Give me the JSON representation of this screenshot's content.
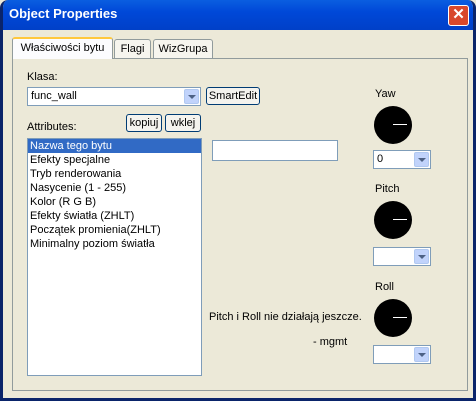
{
  "window": {
    "title": "Object Properties",
    "close_symbol": "✕"
  },
  "tabs": [
    {
      "label": "Właściwości bytu"
    },
    {
      "label": "Flagi"
    },
    {
      "label": "WizGrupa"
    }
  ],
  "klasa": {
    "label": "Klasa:",
    "value": "func_wall"
  },
  "buttons": {
    "smartedit": "SmartEdit",
    "kopiuj": "kopiuj",
    "wklej": "wklej"
  },
  "attributes": {
    "label": "Attributes:",
    "items": [
      "Nazwa tego bytu",
      "Efekty specjalne",
      "Tryb renderowania",
      "Nasycenie (1 - 255)",
      "Kolor (R G B)",
      "Efekty światła (ZHLT)",
      "Początek promienia(ZHLT)",
      "Minimalny poziom światła"
    ]
  },
  "value_field": "",
  "yaw": {
    "label": "Yaw",
    "value": "0"
  },
  "pitch": {
    "label": "Pitch",
    "value": ""
  },
  "roll": {
    "label": "Roll",
    "value": ""
  },
  "note": "Pitch i Roll nie działają jeszcze.",
  "signature": "- mgmt"
}
